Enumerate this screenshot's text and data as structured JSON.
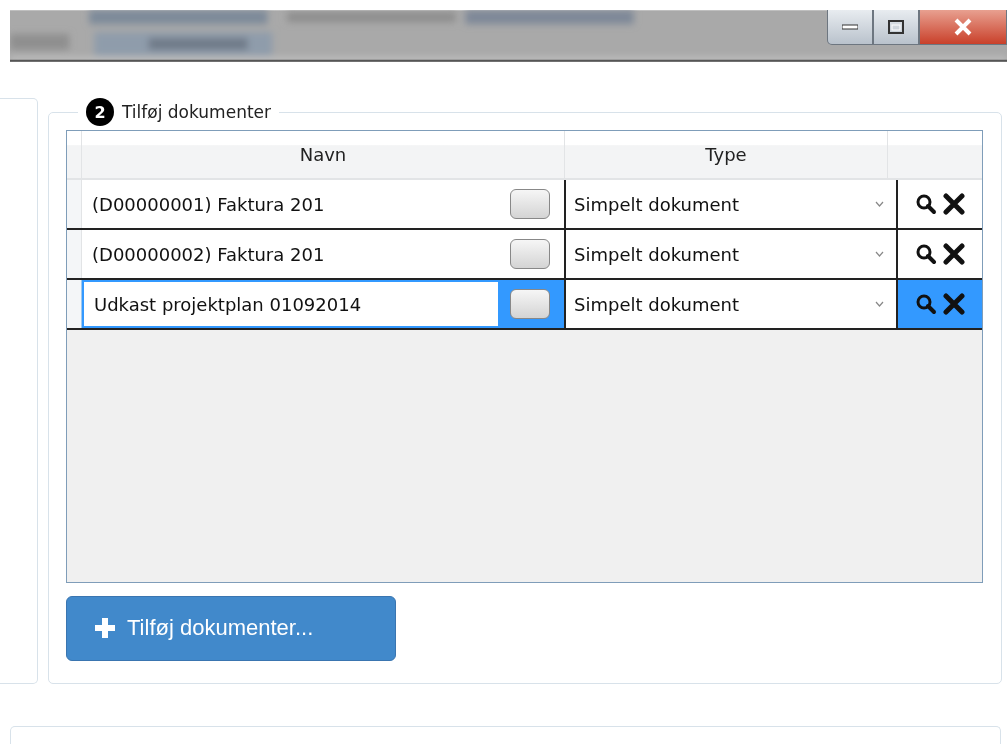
{
  "section": {
    "step": "2",
    "title": "Tilføj dokumenter"
  },
  "table": {
    "columns": [
      "Navn",
      "Type"
    ],
    "rows": [
      {
        "name": "(D00000001) Faktura 201",
        "type": "Simpelt dokument",
        "selected": false
      },
      {
        "name": "(D00000002) Faktura 201",
        "type": "Simpelt dokument",
        "selected": false
      },
      {
        "name": "Udkast projektplan 01092014",
        "type": "Simpelt dokument",
        "selected": true
      }
    ]
  },
  "add_button": {
    "label": "Tilføj dokumenter..."
  }
}
